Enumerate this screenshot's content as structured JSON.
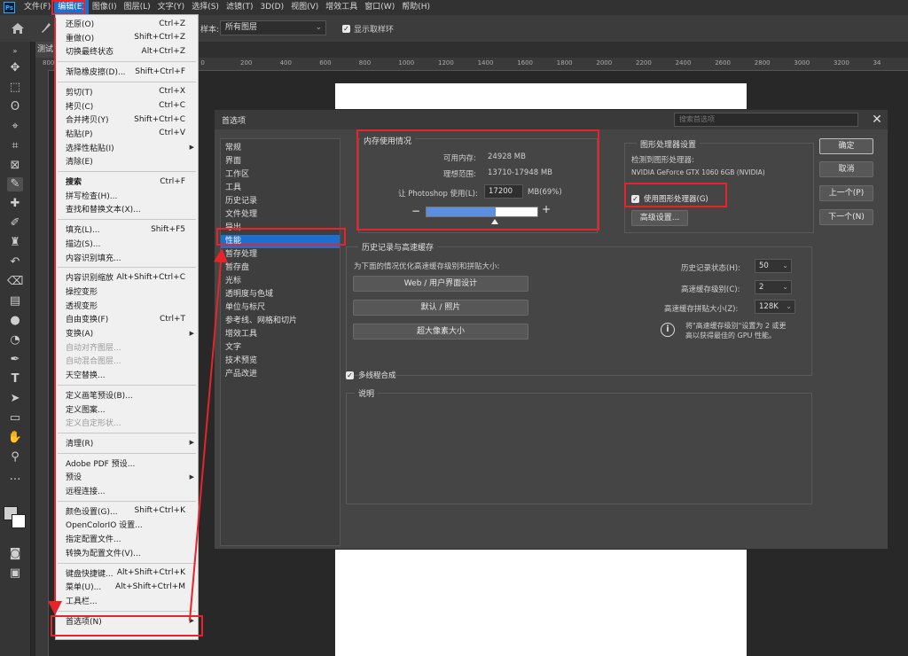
{
  "menubar": {
    "items": [
      "文件(F)",
      "编辑(E)",
      "图像(I)",
      "图层(L)",
      "文字(Y)",
      "选择(S)",
      "滤镜(T)",
      "3D(D)",
      "视图(V)",
      "增效工具",
      "窗口(W)",
      "帮助(H)"
    ]
  },
  "options_bar": {
    "sample_label": "样本:",
    "sample_value": "所有图层",
    "show_ring_label": "显示取样环"
  },
  "document_tab": "测试",
  "ruler_ticks": [
    "800",
    "600",
    "400",
    "200",
    "0",
    "200",
    "400",
    "600",
    "800",
    "1000",
    "1200",
    "1400",
    "1600",
    "1800",
    "2000",
    "2200",
    "2400",
    "2600",
    "2800",
    "3000",
    "3200",
    "34"
  ],
  "edit_menu": {
    "items": [
      {
        "label": "还原(O)",
        "shortcut": "Ctrl+Z",
        "state": "normal"
      },
      {
        "label": "重做(O)",
        "shortcut": "Shift+Ctrl+Z",
        "state": "normal"
      },
      {
        "label": "切换最终状态",
        "shortcut": "Alt+Ctrl+Z",
        "state": "normal"
      },
      {
        "label": "渐隐橡皮擦(D)...",
        "shortcut": "Shift+Ctrl+F",
        "state": "normal"
      },
      {
        "label": "剪切(T)",
        "shortcut": "Ctrl+X",
        "state": "normal"
      },
      {
        "label": "拷贝(C)",
        "shortcut": "Ctrl+C",
        "state": "normal"
      },
      {
        "label": "合并拷贝(Y)",
        "shortcut": "Shift+Ctrl+C",
        "state": "normal"
      },
      {
        "label": "粘贴(P)",
        "shortcut": "Ctrl+V",
        "state": "normal"
      },
      {
        "label": "选择性粘贴(I)",
        "shortcut": "",
        "state": "normal",
        "submenu": true
      },
      {
        "label": "清除(E)",
        "shortcut": "",
        "state": "normal"
      },
      {
        "label": "搜索",
        "shortcut": "Ctrl+F",
        "state": "bold"
      },
      {
        "label": "拼写检查(H)...",
        "shortcut": "",
        "state": "normal"
      },
      {
        "label": "查找和替换文本(X)...",
        "shortcut": "",
        "state": "normal"
      },
      {
        "label": "填充(L)...",
        "shortcut": "Shift+F5",
        "state": "normal"
      },
      {
        "label": "描边(S)...",
        "shortcut": "",
        "state": "normal"
      },
      {
        "label": "内容识别填充...",
        "shortcut": "",
        "state": "normal"
      },
      {
        "label": "内容识别缩放",
        "shortcut": "Alt+Shift+Ctrl+C",
        "state": "normal"
      },
      {
        "label": "操控变形",
        "shortcut": "",
        "state": "normal"
      },
      {
        "label": "透视变形",
        "shortcut": "",
        "state": "normal"
      },
      {
        "label": "自由变换(F)",
        "shortcut": "Ctrl+T",
        "state": "normal"
      },
      {
        "label": "变换(A)",
        "shortcut": "",
        "state": "normal",
        "submenu": true
      },
      {
        "label": "自动对齐图层...",
        "shortcut": "",
        "state": "disabled"
      },
      {
        "label": "自动混合图层...",
        "shortcut": "",
        "state": "disabled"
      },
      {
        "label": "天空替换...",
        "shortcut": "",
        "state": "normal"
      },
      {
        "label": "定义画笔预设(B)...",
        "shortcut": "",
        "state": "normal"
      },
      {
        "label": "定义图案...",
        "shortcut": "",
        "state": "normal"
      },
      {
        "label": "定义自定形状...",
        "shortcut": "",
        "state": "disabled"
      },
      {
        "label": "清理(R)",
        "shortcut": "",
        "state": "normal",
        "submenu": true
      },
      {
        "label": "Adobe PDF 预设...",
        "shortcut": "",
        "state": "normal"
      },
      {
        "label": "预设",
        "shortcut": "",
        "state": "normal",
        "submenu": true
      },
      {
        "label": "远程连接...",
        "shortcut": "",
        "state": "normal"
      },
      {
        "label": "颜色设置(G)...",
        "shortcut": "Shift+Ctrl+K",
        "state": "normal"
      },
      {
        "label": "OpenColorIO 设置...",
        "shortcut": "",
        "state": "normal"
      },
      {
        "label": "指定配置文件...",
        "shortcut": "",
        "state": "normal"
      },
      {
        "label": "转换为配置文件(V)...",
        "shortcut": "",
        "state": "normal"
      },
      {
        "label": "键盘快捷键...",
        "shortcut": "Alt+Shift+Ctrl+K",
        "state": "normal"
      },
      {
        "label": "菜单(U)...",
        "shortcut": "Alt+Shift+Ctrl+M",
        "state": "normal"
      },
      {
        "label": "工具栏...",
        "shortcut": "",
        "state": "normal"
      },
      {
        "label": "首选项(N)",
        "shortcut": "",
        "state": "normal",
        "submenu": true
      }
    ]
  },
  "dialog": {
    "title": "首选项",
    "search_placeholder": "搜索首选项",
    "categories": [
      "常规",
      "界面",
      "工作区",
      "工具",
      "历史记录",
      "文件处理",
      "导出",
      "性能",
      "暂存处理",
      "暂存盘",
      "光标",
      "透明度与色域",
      "单位与标尺",
      "参考线、网格和切片",
      "增效工具",
      "文字",
      "技术预览",
      "产品改进"
    ],
    "selected_category": "性能",
    "memory": {
      "title": "内存使用情况",
      "available_label": "可用内存:",
      "available_value": "24928 MB",
      "ideal_label": "理想范围:",
      "ideal_value": "13710-17948 MB",
      "use_label": "让 Photoshop 使用(L):",
      "use_value": "17200",
      "use_unit": "MB(69%)",
      "slider_fraction": 0.69
    },
    "gpu": {
      "title": "图形处理器设置",
      "detected_label": "检测到图形处理器:",
      "detected_value": "NVIDIA GeForce GTX 1060 6GB (NVIDIA)",
      "use_gpu_label": "使用图形处理器(G)",
      "advanced_button": "高级设置..."
    },
    "history": {
      "title": "历史记录与高速缓存",
      "optimize_label": "为下面的情况优化高速缓存级别和拼贴大小:",
      "preset_buttons": [
        "Web / 用户界面设计",
        "默认 / 照片",
        "超大像素大小"
      ],
      "history_states_label": "历史记录状态(H):",
      "history_states_value": "50",
      "cache_levels_label": "高速缓存级别(C):",
      "cache_levels_value": "2",
      "tile_size_label": "高速缓存拼贴大小(Z):",
      "tile_size_value": "128K",
      "info_text_1": "将\"高速缓存级别\"设置为 2 或更",
      "info_text_2": "高以获得最佳的 GPU 性能。"
    },
    "multithread_label": "多线程合成",
    "description_title": "说明",
    "buttons": {
      "ok": "确定",
      "cancel": "取消",
      "prev": "上一个(P)",
      "next": "下一个(N)"
    }
  }
}
